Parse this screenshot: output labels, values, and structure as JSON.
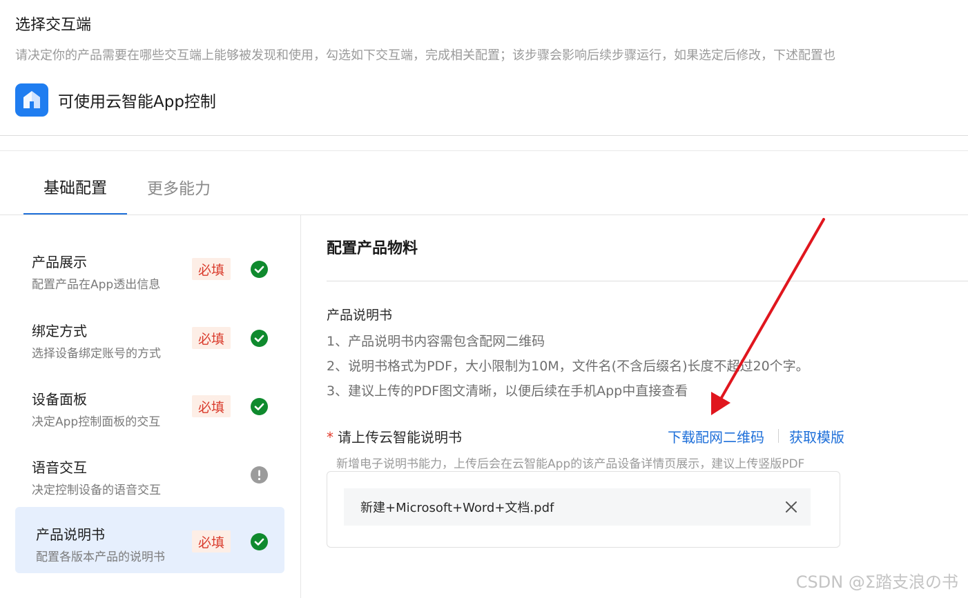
{
  "page": {
    "title": "选择交互端",
    "description": "请决定你的产品需要在哪些交互端上能够被发现和使用，勾选如下交互端，完成相关配置；该步骤会影响后续步骤运行，如果选定后修改，下述配置也"
  },
  "channel": {
    "icon": "cloud-app-icon",
    "label": "可使用云智能App控制",
    "brand_color": "#1f7df0"
  },
  "tabs": [
    {
      "label": "基础配置",
      "active": true
    },
    {
      "label": "更多能力",
      "active": false
    }
  ],
  "sidebar": {
    "items": [
      {
        "title": "产品展示",
        "subtitle": "配置产品在App透出信息",
        "badge": "必填",
        "status": "done"
      },
      {
        "title": "绑定方式",
        "subtitle": "选择设备绑定账号的方式",
        "badge": "必填",
        "status": "done"
      },
      {
        "title": "设备面板",
        "subtitle": "决定App控制面板的交互",
        "badge": "必填",
        "status": "done"
      },
      {
        "title": "语音交互",
        "subtitle": "决定控制设备的语音交互",
        "badge": "",
        "status": "warning"
      },
      {
        "title": "产品说明书",
        "subtitle": "配置各版本产品的说明书",
        "badge": "必填",
        "status": "done",
        "active": true
      }
    ]
  },
  "main": {
    "section_title": "配置产品物料",
    "manual_title": "产品说明书",
    "rules": [
      "1、产品说明书内容需包含配网二维码",
      "2、说明书格式为PDF，大小限制为10M，文件名(不含后缀名)长度不超过20个字。",
      "3、建议上传的PDF图文清晰，以便后续在手机App中直接查看"
    ],
    "upload": {
      "required_mark": "*",
      "label": "请上传云智能说明书",
      "link_download_qr": "下载配网二维码",
      "link_template": "获取模版",
      "hint": "新增电子说明书能力，上传后会在云智能App的该产品设备详情页展示，建议上传竖版PDF",
      "file_name": "新建+Microsoft+Word+文档.pdf"
    }
  },
  "watermark": "CSDN @Σ踏支浪の书",
  "colors": {
    "link": "#1e6fd9",
    "success": "#0f8a2e",
    "warning": "#9b9b9b",
    "badge_bg": "#fdeee6",
    "badge_text": "#d93a2b",
    "active_item_bg": "#e6effd",
    "annotation_arrow": "#e0161e"
  }
}
